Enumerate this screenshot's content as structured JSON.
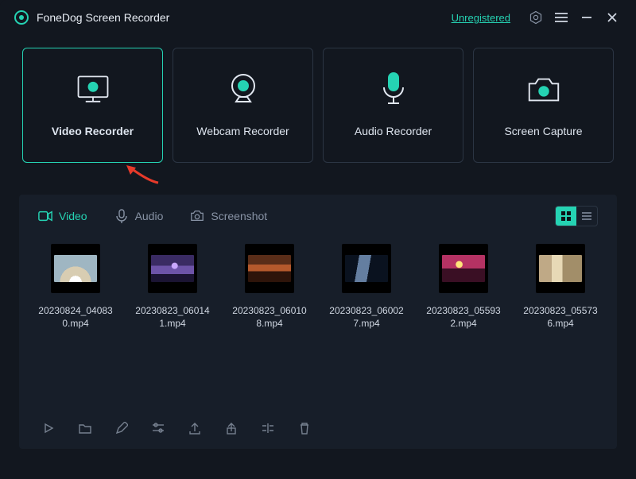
{
  "header": {
    "app_title": "FoneDog Screen Recorder",
    "register_label": "Unregistered"
  },
  "modes": [
    {
      "id": "video-recorder",
      "label": "Video Recorder",
      "active": true
    },
    {
      "id": "webcam-recorder",
      "label": "Webcam Recorder",
      "active": false
    },
    {
      "id": "audio-recorder",
      "label": "Audio Recorder",
      "active": false
    },
    {
      "id": "screen-capture",
      "label": "Screen Capture",
      "active": false
    }
  ],
  "library": {
    "tabs": {
      "video": "Video",
      "audio": "Audio",
      "screenshot": "Screenshot",
      "active": "video"
    },
    "view": "grid",
    "files": [
      {
        "name": "20230824_040830.mp4"
      },
      {
        "name": "20230823_060141.mp4"
      },
      {
        "name": "20230823_060108.mp4"
      },
      {
        "name": "20230823_060027.mp4"
      },
      {
        "name": "20230823_055932.mp4"
      },
      {
        "name": "20230823_055736.mp4"
      }
    ],
    "toolbar": {
      "play": "Play",
      "folder": "Open folder",
      "rename": "Rename",
      "settings": "Preferences",
      "export": "Export",
      "share": "Share",
      "merge": "Merge",
      "delete": "Delete"
    }
  },
  "colors": {
    "accent": "#25d3b3"
  }
}
